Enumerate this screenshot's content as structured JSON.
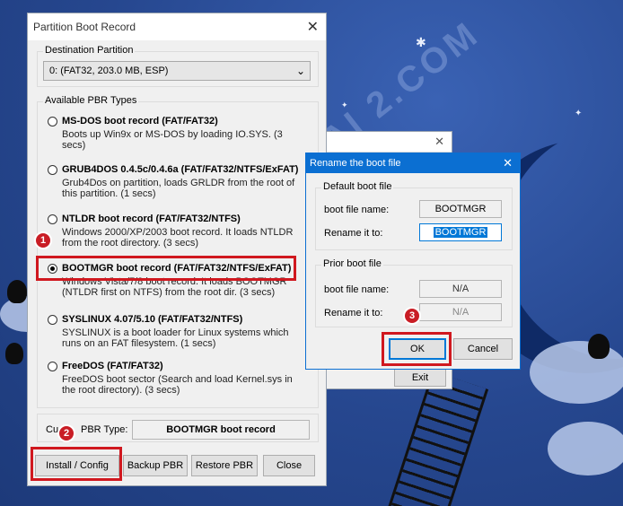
{
  "main_window": {
    "title": "Partition Boot Record",
    "close_glyph": "✕",
    "destination_label": "Destination Partition",
    "destination_value": "0: (FAT32, 203.0 MB, ESP)",
    "available_label": "Available PBR Types",
    "options": [
      {
        "title": "MS-DOS boot record (FAT/FAT32)",
        "desc": "Boots up Win9x or MS-DOS by loading IO.SYS. (3 secs)",
        "checked": false
      },
      {
        "title": "GRUB4DOS 0.4.5c/0.4.6a (FAT/FAT32/NTFS/ExFAT)",
        "desc": "Grub4Dos on partition, loads GRLDR from the root of this partition. (1 secs)",
        "checked": false
      },
      {
        "title": "NTLDR boot record (FAT/FAT32/NTFS)",
        "desc": "Windows 2000/XP/2003 boot record. It loads NTLDR from the root directory. (3 secs)",
        "checked": false
      },
      {
        "title": "BOOTMGR boot record (FAT/FAT32/NTFS/ExFAT)",
        "desc": "Windows Vista/7/8 boot record. It loads BOOTMGR (NTLDR first on NTFS) from the root dir. (3 secs)",
        "checked": true
      },
      {
        "title": "SYSLINUX 4.07/5.10 (FAT/FAT32/NTFS)",
        "desc": "SYSLINUX is a boot loader for Linux systems which runs on an FAT filesystem. (1 secs)",
        "checked": false
      },
      {
        "title": "FreeDOS (FAT/FAT32)",
        "desc": "FreeDOS boot sector (Search and load Kernel.sys in the root directory). (3 secs)",
        "checked": false
      }
    ],
    "current_label_left": "Cu",
    "current_label_right": "PBR Type:",
    "current_value": "BOOTMGR boot record",
    "buttons": {
      "install": "Install / Config",
      "backup": "Backup PBR",
      "restore": "Restore PBR",
      "close": "Close"
    }
  },
  "back_window": {
    "exit_label": "Exit"
  },
  "rename_dialog": {
    "title": "Rename the boot file",
    "close_glyph": "✕",
    "default_group": "Default boot file",
    "boot_file_name_label": "boot file name:",
    "boot_file_name_value": "BOOTMGR",
    "rename_label": "Rename it to:",
    "rename_value": "BOOTMGR",
    "prior_group": "Prior boot file",
    "prior_name_label": "boot file name:",
    "prior_name_value": "N/A",
    "prior_rename_label": "Rename it to:",
    "prior_rename_value": "N/A",
    "ok_label": "OK",
    "cancel_label": "Cancel"
  },
  "annotations": {
    "step1": "1",
    "step2": "2",
    "step3": "3"
  },
  "watermark": "TAI 2.COM",
  "colors": {
    "highlight": "#d0181f",
    "accent": "#0078d7"
  }
}
